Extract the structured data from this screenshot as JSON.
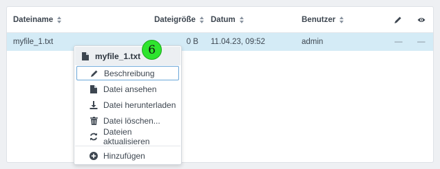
{
  "table": {
    "columns": {
      "name": "Dateiname",
      "size": "Dateigröße",
      "date": "Datum",
      "user": "Benutzer"
    },
    "icons": {
      "edit": "pencil-icon",
      "view": "eye-icon"
    },
    "rows": [
      {
        "name": "myfile_1.txt",
        "size": "0 B",
        "date": "11.04.23, 09:52",
        "user": "admin",
        "edit": "—",
        "view": "—"
      }
    ]
  },
  "badge": {
    "label": "6",
    "color": "#2ee42e"
  },
  "context_menu": {
    "title": "myfile_1.txt",
    "title_icon": "file-icon",
    "items": [
      {
        "label": "Beschreibung",
        "icon": "pencil-icon",
        "selected": true
      },
      {
        "label": "Datei ansehen",
        "icon": "file-icon"
      },
      {
        "label": "Datei herunterladen",
        "icon": "download-icon"
      },
      {
        "label": "Datei löschen...",
        "icon": "trash-icon"
      },
      {
        "label": "Dateien aktualisieren",
        "icon": "refresh-icon"
      },
      {
        "label": "Hinzufügen",
        "icon": "plus-circle-icon"
      }
    ]
  },
  "colors": {
    "row_highlight": "#d4ebf6",
    "selected_border": "#6aa6d8",
    "text": "#3d4650"
  }
}
